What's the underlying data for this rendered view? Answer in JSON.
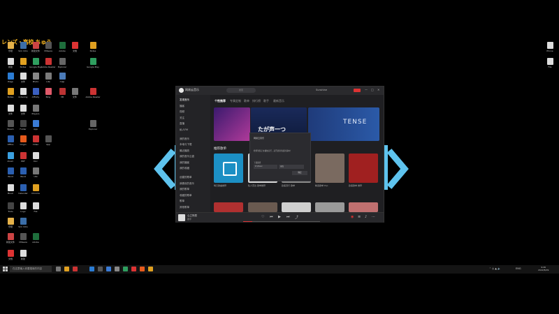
{
  "wallpaper": {
    "text": "レンズ・高校 ちゅう",
    "logo_color": "#5ec3ee"
  },
  "desktop_icons": [
    {
      "label": "乐吧",
      "color": "#e6b24a"
    },
    {
      "label": "Sim Intro",
      "color": "#3b6ea8"
    },
    {
      "label": "新建文件",
      "color": "#c44"
    },
    {
      "label": "VMware",
      "color": "#555"
    },
    {
      "label": "Adobe",
      "color": "#1e6e3c"
    },
    {
      "label": "文档",
      "color": "#d33"
    },
    {
      "label": "新建",
      "color": "#ddd"
    },
    {
      "label": "Notes",
      "color": "#e0a020"
    },
    {
      "label": "Google Play",
      "color": "#2f9e5f"
    },
    {
      "label": "Adobe Reader",
      "color": "#c33"
    },
    {
      "label": "Explorer",
      "color": "#666"
    },
    {
      "label": "Edge",
      "color": "#2b7cd3"
    },
    {
      "label": "文件",
      "color": "#ddd"
    },
    {
      "label": "Photo",
      "color": "#888"
    },
    {
      "label": "Lite",
      "color": "#7a7a7a"
    },
    {
      "label": "map",
      "color": "#4a7ab8"
    },
    {
      "label": "Notes",
      "color": "#e0a020"
    },
    {
      "label": "Indexing",
      "color": "#ddd"
    },
    {
      "label": "Affinity",
      "color": "#3a5fc0"
    },
    {
      "label": "Bing",
      "color": "#e05a6a"
    },
    {
      "label": "VB",
      "color": "#b33"
    },
    {
      "label": "文件",
      "color": "#777"
    },
    {
      "label": "文件",
      "color": "#ddd"
    },
    {
      "label": "文件",
      "color": "#ddd"
    },
    {
      "label": "Players",
      "color": "#777"
    },
    {
      "label": "Steam",
      "color": "#555"
    },
    {
      "label": "Folder",
      "color": "#444"
    },
    {
      "label": "App",
      "color": "#3a7bd5"
    },
    {
      "label": "Office",
      "color": "#2b5fb0"
    },
    {
      "label": "Origin",
      "color": "#e55a1c"
    },
    {
      "label": "Video",
      "color": "#c33"
    },
    {
      "label": "App",
      "color": "#555"
    },
    {
      "label": "Zoom",
      "color": "#3aa0e0"
    },
    {
      "label": "PDF",
      "color": "#c33"
    },
    {
      "label": "Doc",
      "color": "#ddd"
    },
    {
      "label": "Word",
      "color": "#2b5fb0"
    },
    {
      "label": "Word",
      "color": "#2b5fb0"
    },
    {
      "label": "Util",
      "color": "#777"
    },
    {
      "label": "Music",
      "color": "#ddd"
    },
    {
      "label": "Calendar",
      "color": "#2b5fb0"
    },
    {
      "label": "Chrome",
      "color": "#e0a020"
    },
    {
      "label": "Tools",
      "color": "#444"
    },
    {
      "label": "Logo",
      "color": "#ddd"
    },
    {
      "label": "File",
      "color": "#ddd"
    }
  ],
  "right_icons": [
    {
      "label": "Phone",
      "color": "#ddd"
    },
    {
      "label": "File",
      "color": "#ddd"
    }
  ],
  "app": {
    "name": "网易云音乐",
    "search_placeholder": "搜索",
    "user": "Sunshine",
    "window_buttons": [
      "—",
      "□",
      "✕"
    ],
    "sidebar": [
      {
        "label": "发现音乐",
        "active": true
      },
      {
        "label": "播客",
        "active": false
      },
      {
        "label": "视频",
        "active": false
      },
      {
        "label": "关注",
        "active": false
      },
      {
        "label": "直播",
        "active": false
      },
      {
        "label": "私人FM",
        "active": false
      },
      {
        "label": "我的音乐",
        "active": false
      },
      {
        "label": "本地与下载",
        "active": false
      },
      {
        "label": "最近播放",
        "active": false
      },
      {
        "label": "我的音乐云盘",
        "active": false
      },
      {
        "label": "我的播客",
        "active": false
      },
      {
        "label": "我的收藏",
        "active": false
      },
      {
        "label": "创建的歌单",
        "active": false
      },
      {
        "label": "我喜欢的音乐",
        "active": false
      },
      {
        "label": "我的歌单",
        "active": false
      },
      {
        "label": "收藏的歌单",
        "active": false
      },
      {
        "label": "歌单",
        "active": false
      },
      {
        "label": "其他歌单",
        "active": false
      }
    ],
    "tabs": [
      {
        "label": "个性推荐",
        "active": true
      },
      {
        "label": "专属定制",
        "active": false
      },
      {
        "label": "歌单",
        "active": false
      },
      {
        "label": "排行榜",
        "active": false
      },
      {
        "label": "歌手",
        "active": false
      },
      {
        "label": "最新音乐",
        "active": false
      }
    ],
    "banner_text": "たが声一つ",
    "banner_right": "TENSE",
    "section_title": "推荐歌单",
    "cards": [
      {
        "caption": "每日歌曲推荐",
        "color": "#1c8fc4"
      },
      {
        "caption": "私人雷达 歌单推荐",
        "color": "#d8d8d8"
      },
      {
        "caption": "欧美流行 歌单",
        "color": "#8a8a8a"
      },
      {
        "caption": "精选歌单 Pop",
        "color": "#7a6a60"
      },
      {
        "caption": "欧美歌单 推荐",
        "color": "#a02020"
      }
    ],
    "dialog": {
      "title": "网易云音乐",
      "text": "检测到您正在播放音乐，是否更新到最新版本？",
      "label": "下载路径",
      "field1": "D:\\Music",
      "field2": "更改",
      "button": "确定"
    },
    "player": {
      "song": "心之所愿",
      "artist": "歌手",
      "progress": 0.12
    }
  },
  "taskbar": {
    "search_placeholder": "在这里输入你要搜索的内容",
    "clock_time": "9:26",
    "clock_date": "2022/8/29",
    "tray_text": "ENG"
  }
}
